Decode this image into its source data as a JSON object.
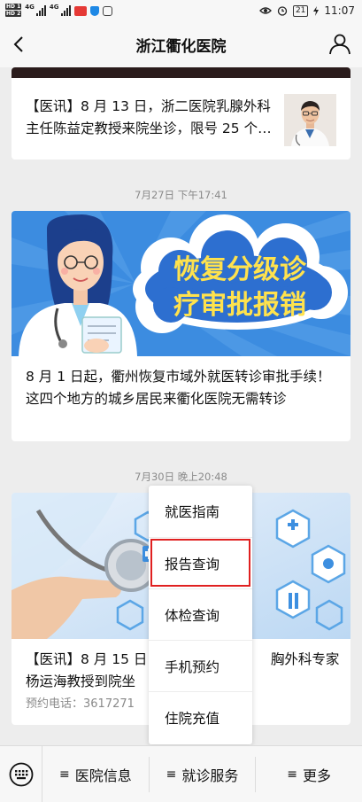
{
  "status_bar": {
    "time": "11:07",
    "battery": "21",
    "network_tag": "4G"
  },
  "nav": {
    "title": "浙江衢化医院"
  },
  "articles": [
    {
      "title": "【医讯】8 月 13 日，浙二医院乳腺外科主任陈益定教授来院坐诊，限号 25 个…"
    },
    {
      "timestamp": "7月27日 下午17:41",
      "banner_lines": [
        "恢复分级诊",
        "疗审批报销"
      ],
      "title": "8 月 1 日起，衢州恢复市域外就医转诊审批手续！这四个地方的城乡居民来衢化医院无需转诊"
    },
    {
      "timestamp": "7月30日 晚上20:48",
      "title": "【医讯】8 月 15 日，胸外科专家杨运海教授到院坐诊",
      "title_left": "【医讯】8 月 15 日，",
      "title_right": "胸外科专家",
      "title_line2": "杨运海教授到院坐",
      "phone": "预约电话：3617271"
    }
  ],
  "popup_menu": {
    "items": [
      "就医指南",
      "报告查询",
      "体检查询",
      "手机预约",
      "住院充值"
    ],
    "selected_index": 1
  },
  "bottom_menu": {
    "items": [
      "医院信息",
      "就诊服务",
      "更多"
    ],
    "prefix": "≡"
  },
  "colors": {
    "accent_blue": "#2a8be0",
    "banner_yellow": "#ffe24d",
    "selection_red": "#e02020"
  }
}
